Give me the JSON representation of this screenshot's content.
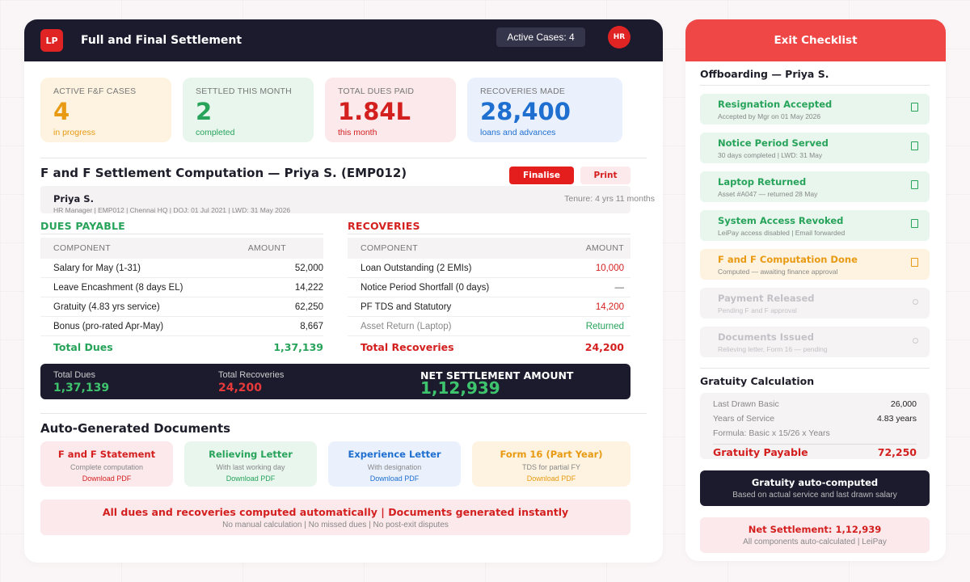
{
  "header": {
    "logo": "LP",
    "title": "Full and Final Settlement",
    "active_cases": "Active Cases: 4",
    "avatar": "HR"
  },
  "stats": [
    {
      "label": "ACTIVE F&F CASES",
      "value": "4",
      "sub": "in progress",
      "color": "#e89a12",
      "bg": "#fdf3e0"
    },
    {
      "label": "SETTLED THIS MONTH",
      "value": "2",
      "sub": "completed",
      "color": "#27a35a",
      "bg": "#e8f6ee"
    },
    {
      "label": "TOTAL DUES PAID",
      "value": "1.84L",
      "sub": "this month",
      "color": "#d41f1f",
      "bg": "#fbe9ec"
    },
    {
      "label": "RECOVERIES MADE",
      "value": "28,400",
      "sub": "loans and advances",
      "color": "#1e6fd0",
      "bg": "#eaf1fd"
    }
  ],
  "computation": {
    "title": "F and F Settlement Computation — Priya S. (EMP012)",
    "finalise_label": "Finalise",
    "print_label": "Print",
    "employee_name": "Priya S.",
    "employee_meta": "HR Manager | EMP012 | Chennai HQ | DOJ: 01 Jul 2021 | LWD: 31 May 2026",
    "tenure": "Tenure: 4 yrs 11 months"
  },
  "dues": {
    "title": "DUES PAYABLE",
    "col_component": "COMPONENT",
    "col_amount": "AMOUNT",
    "rows": [
      {
        "component": "Salary for May (1-31)",
        "amount": "52,000"
      },
      {
        "component": "Leave Encashment (8 days EL)",
        "amount": "14,222"
      },
      {
        "component": "Gratuity (4.83 yrs service)",
        "amount": "62,250"
      },
      {
        "component": "Bonus (pro-rated Apr-May)",
        "amount": "8,667"
      }
    ],
    "total_label": "Total Dues",
    "total_value": "1,37,139"
  },
  "recoveries": {
    "title": "RECOVERIES",
    "col_component": "COMPONENT",
    "col_amount": "AMOUNT",
    "rows": [
      {
        "component": "Loan Outstanding (2 EMIs)",
        "amount": "10,000"
      },
      {
        "component": "Notice Period Shortfall (0 days)",
        "amount": "—"
      },
      {
        "component": "PF TDS and Statutory",
        "amount": "14,200"
      },
      {
        "component": "Asset Return (Laptop)",
        "amount": "Returned"
      }
    ],
    "total_label": "Total Recoveries",
    "total_value": "24,200"
  },
  "net_bar": {
    "dues_label": "Total Dues",
    "dues_value": "1,37,139",
    "recoveries_label": "Total Recoveries",
    "recoveries_value": "24,200",
    "net_label": "NET SETTLEMENT AMOUNT",
    "net_value": "1,12,939"
  },
  "documents": {
    "title": "Auto-Generated Documents",
    "items": [
      {
        "title": "F and F Statement",
        "sub": "Complete computation",
        "link": "Download PDF"
      },
      {
        "title": "Relieving Letter",
        "sub": "With last working day",
        "link": "Download PDF"
      },
      {
        "title": "Experience Letter",
        "sub": "With designation",
        "link": "Download PDF"
      },
      {
        "title": "Form 16 (Part Year)",
        "sub": "TDS for partial FY",
        "link": "Download PDF"
      }
    ]
  },
  "banner": {
    "title": "All dues and recoveries computed automatically | Documents generated instantly",
    "sub": "No manual calculation | No missed dues | No post-exit disputes"
  },
  "checklist": {
    "title": "Exit Checklist",
    "subtitle": "Offboarding — Priya S.",
    "items": [
      {
        "title": "Resignation Accepted",
        "sub": "Accepted by Mgr on 01 May 2026",
        "status": "done"
      },
      {
        "title": "Notice Period Served",
        "sub": "30 days completed | LWD: 31 May",
        "status": "done"
      },
      {
        "title": "Laptop Returned",
        "sub": "Asset #A047 — returned 28 May",
        "status": "done"
      },
      {
        "title": "System Access Revoked",
        "sub": "LeiPay access disabled | Email forwarded",
        "status": "done"
      },
      {
        "title": "F and F Computation Done",
        "sub": "Computed — awaiting finance approval",
        "status": "pending"
      },
      {
        "title": "Payment Released",
        "sub": "Pending F and F approval",
        "status": "todo"
      },
      {
        "title": "Documents Issued",
        "sub": "Relieving letter, Form 16 — pending",
        "status": "todo"
      }
    ]
  },
  "gratuity": {
    "title": "Gratuity Calculation",
    "basic_label": "Last Drawn Basic",
    "basic_value": "26,000",
    "years_label": "Years of Service",
    "years_value": "4.83 years",
    "formula": "Formula: Basic x 15/26 x Years",
    "payable_label": "Gratuity Payable",
    "payable_value": "72,250"
  },
  "auto_box": {
    "title": "Gratuity auto-computed",
    "sub": "Based on actual service and last drawn salary"
  },
  "net_box": {
    "title": "Net Settlement: 1,12,939",
    "sub": "All components auto-calculated | LeiPay"
  },
  "colors": {
    "dark": "#1c1b2e",
    "red": "#d41f1f",
    "green": "#27a35a",
    "amber": "#e89a12",
    "blue": "#1e6fd0"
  }
}
